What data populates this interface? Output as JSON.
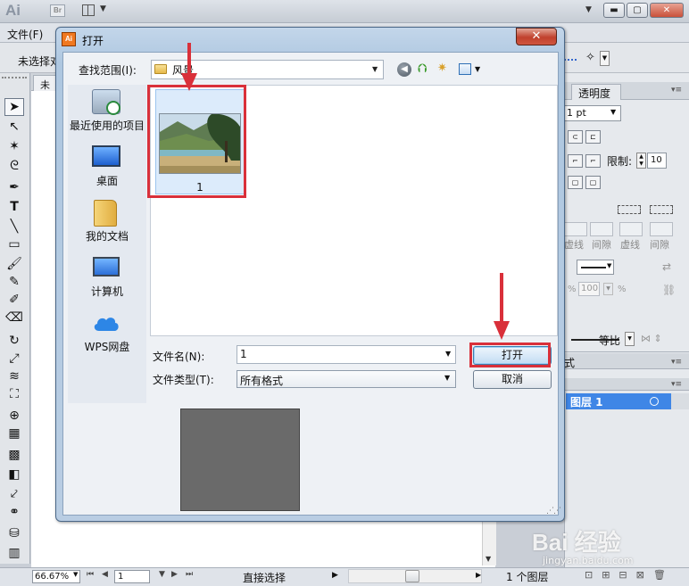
{
  "app": {
    "logo_text": "Ai",
    "bridge_badge": "Br",
    "menu_file": "文件(F)",
    "control_noselect": "未选择对",
    "doc_tab": "未标",
    "status": {
      "zoom": "66.67%",
      "page": "1",
      "tool": "直接选择"
    }
  },
  "right_panel": {
    "tab_transparency": "透明度",
    "stroke_weight": "1 pt",
    "limit_label": "限制:",
    "limit_value": "10",
    "dash_labels": [
      "虚线",
      "间隙",
      "虚线",
      "间隙"
    ],
    "percent_value": "100",
    "percent_unit": "%",
    "scale_label": "等比"
  },
  "layers_panel": {
    "tab_suffix": "式",
    "layer_name": "图层 1",
    "layer_count": "1 个图层"
  },
  "dialog": {
    "title": "打开",
    "close_label": "✕",
    "look_in_label": "查找范围(I):",
    "look_in_value": "风景",
    "places": [
      {
        "label": "最近使用的项目",
        "icon": "recent-items-icon"
      },
      {
        "label": "桌面",
        "icon": "desktop-icon"
      },
      {
        "label": "我的文档",
        "icon": "documents-folder-icon"
      },
      {
        "label": "计算机",
        "icon": "computer-icon"
      },
      {
        "label": "WPS网盘",
        "icon": "cloud-drive-icon"
      }
    ],
    "files": [
      {
        "name": "1"
      }
    ],
    "file_name_label": "文件名(N):",
    "file_name_value": "1",
    "file_type_label": "文件类型(T):",
    "file_type_value": "所有格式",
    "open_button": "打开",
    "cancel_button": "取消"
  },
  "colors": {
    "annotation_red": "#d9303a",
    "selected_layer": "#3f86e6",
    "dialog_frame": "#b9cde3"
  },
  "watermark": {
    "logo": "Bai 经验",
    "url": "jingyan.baidu.com"
  }
}
